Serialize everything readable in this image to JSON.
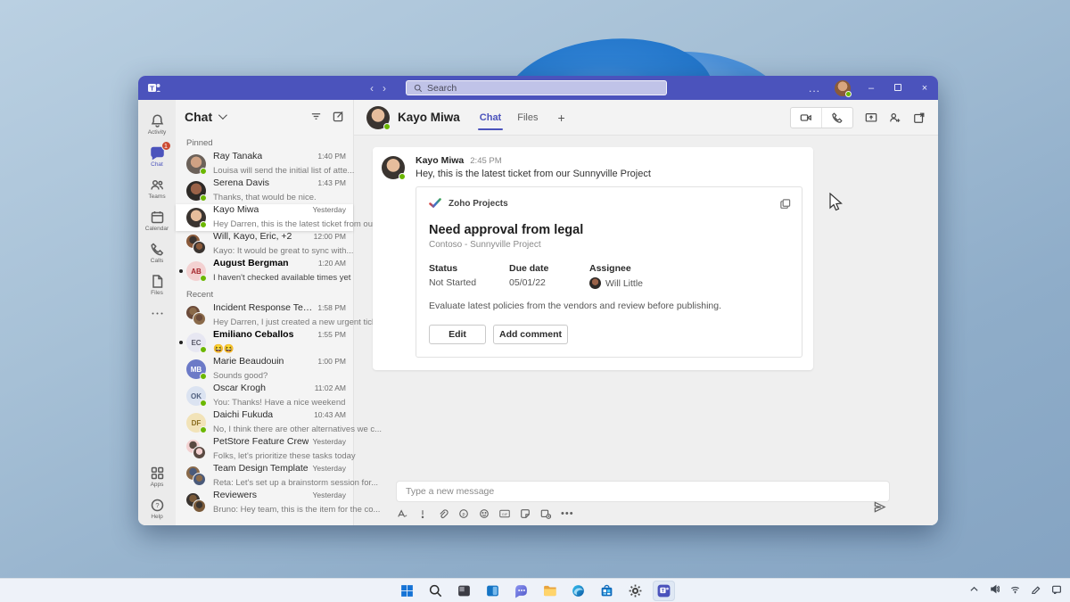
{
  "colors": {
    "accent": "#4b53bc",
    "presence_green": "#6bb700",
    "badge_red": "#cc4a31"
  },
  "window": {
    "titlebar": {
      "search_placeholder": "Search",
      "more_label": "...",
      "minimize": "–",
      "close": "×"
    },
    "rail": {
      "items": [
        {
          "id": "activity",
          "label": "Activity",
          "icon": "bell"
        },
        {
          "id": "chat",
          "label": "Chat",
          "icon": "chat",
          "active": true,
          "badge": "1"
        },
        {
          "id": "teams",
          "label": "Teams",
          "icon": "teams"
        },
        {
          "id": "calendar",
          "label": "Calendar",
          "icon": "calendar"
        },
        {
          "id": "calls",
          "label": "Calls",
          "icon": "phone"
        },
        {
          "id": "files",
          "label": "Files",
          "icon": "file"
        },
        {
          "id": "more",
          "label": "",
          "icon": "dots"
        }
      ],
      "bottom_items": [
        {
          "id": "apps",
          "label": "Apps",
          "icon": "grid"
        },
        {
          "id": "help",
          "label": "Help",
          "icon": "help"
        }
      ]
    },
    "chat_list": {
      "title": "Chat",
      "sections": [
        {
          "label": "Pinned",
          "items": [
            {
              "name": "Ray Tanaka",
              "time": "1:40 PM",
              "preview": "Louisa will send the initial list of atte...",
              "presence": true,
              "avatar": {
                "type": "photo",
                "skin": "#cfa284",
                "hair": "#6b6159"
              }
            },
            {
              "name": "Serena Davis",
              "time": "1:43 PM",
              "preview": "Thanks, that would be nice.",
              "presence": true,
              "avatar": {
                "type": "photo",
                "skin": "#9a6248",
                "hair": "#2d2926"
              }
            },
            {
              "name": "Kayo Miwa",
              "time": "Yesterday",
              "preview": "Hey Darren, this is the latest ticket from our ...",
              "selected": true,
              "presence": true,
              "avatar": {
                "type": "photo",
                "skin": "#e6bd9c",
                "hair": "#3a3430"
              }
            },
            {
              "name": "Will, Kayo, Eric, +2",
              "time": "12:00 PM",
              "preview": "Kayo: It would be great to sync with...",
              "avatar": {
                "type": "group",
                "c1": "#8a5a3a",
                "c2": "#3a3430"
              }
            },
            {
              "name": "August Bergman",
              "time": "1:20 AM",
              "preview": "I haven't checked available times yet",
              "unread": true,
              "presence": true,
              "avatar": {
                "type": "initials",
                "text": "AB",
                "bg": "#f3d1d1",
                "fg": "#a4262c"
              }
            }
          ]
        },
        {
          "label": "Recent",
          "items": [
            {
              "name": "Incident Response Team",
              "time": "1:58 PM",
              "preview": "Hey Darren, I just created a new urgent ticket:",
              "avatar": {
                "type": "group",
                "c1": "#6b4b3a",
                "c2": "#8a6a4a"
              }
            },
            {
              "name": "Emiliano Ceballos",
              "time": "1:55 PM",
              "preview": "😆😆",
              "unread": true,
              "presence": true,
              "avatar": {
                "type": "initials",
                "text": "EC",
                "bg": "#e7e7f2",
                "fg": "#5b5b6b"
              }
            },
            {
              "name": "Marie Beaudouin",
              "time": "1:00 PM",
              "preview": "Sounds good?",
              "presence": true,
              "avatar": {
                "type": "initials",
                "text": "MB",
                "bg": "#6c7ac7",
                "fg": "#ffffff"
              }
            },
            {
              "name": "Oscar Krogh",
              "time": "11:02 AM",
              "preview": "You: Thanks! Have a nice weekend",
              "presence": true,
              "avatar": {
                "type": "initials",
                "text": "OK",
                "bg": "#dbe3f1",
                "fg": "#51617f"
              }
            },
            {
              "name": "Daichi Fukuda",
              "time": "10:43 AM",
              "preview": "No, I think there are other alternatives we c...",
              "presence": true,
              "avatar": {
                "type": "initials",
                "text": "DF",
                "bg": "#f2e3b8",
                "fg": "#8a6d1f"
              }
            },
            {
              "name": "PetStore Feature Crew",
              "time": "Yesterday",
              "preview": "Folks, let's prioritize these tasks today",
              "avatar": {
                "type": "group",
                "c1": "#f3d1d1",
                "c2": "#5a4a42"
              }
            },
            {
              "name": "Team Design Template",
              "time": "Yesterday",
              "preview": "Reta: Let's set up a brainstorm session for...",
              "avatar": {
                "type": "group",
                "c1": "#8a6a4a",
                "c2": "#4a5a7a"
              }
            },
            {
              "name": "Reviewers",
              "time": "Yesterday",
              "preview": "Bruno: Hey team, this is the item for the co...",
              "avatar": {
                "type": "group",
                "c1": "#3a3430",
                "c2": "#7a5a3a"
              }
            }
          ]
        }
      ]
    },
    "conversation": {
      "title": "Kayo Miwa",
      "tabs": [
        "Chat",
        "Files"
      ],
      "message": {
        "author": "Kayo Miwa",
        "time": "2:45 PM",
        "text": "Hey, this is the latest ticket from our Sunnyville Project"
      },
      "ticket": {
        "app": "Zoho Projects",
        "title": "Need approval from legal",
        "subtitle": "Contoso - Sunnyville Project",
        "fields": [
          {
            "label": "Status",
            "value": "Not Started"
          },
          {
            "label": "Due date",
            "value": "05/01/22"
          },
          {
            "label": "Assignee",
            "value": "Will Little",
            "has_avatar": true
          }
        ],
        "description": "Evaluate latest policies from the vendors and review before publishing.",
        "buttons": {
          "edit": "Edit",
          "add_comment": "Add comment"
        }
      },
      "compose_placeholder": "Type a new message"
    }
  },
  "taskbar": {
    "items": [
      {
        "name": "start"
      },
      {
        "name": "search"
      },
      {
        "name": "dark-app"
      },
      {
        "name": "blue-panels-app"
      },
      {
        "name": "teams-chat"
      },
      {
        "name": "file-explorer"
      },
      {
        "name": "edge"
      },
      {
        "name": "store"
      },
      {
        "name": "settings"
      },
      {
        "name": "teams",
        "active": true
      }
    ],
    "tray": [
      {
        "name": "chevron-up"
      },
      {
        "name": "volume"
      },
      {
        "name": "network"
      },
      {
        "name": "pen"
      },
      {
        "name": "notifications"
      }
    ]
  }
}
